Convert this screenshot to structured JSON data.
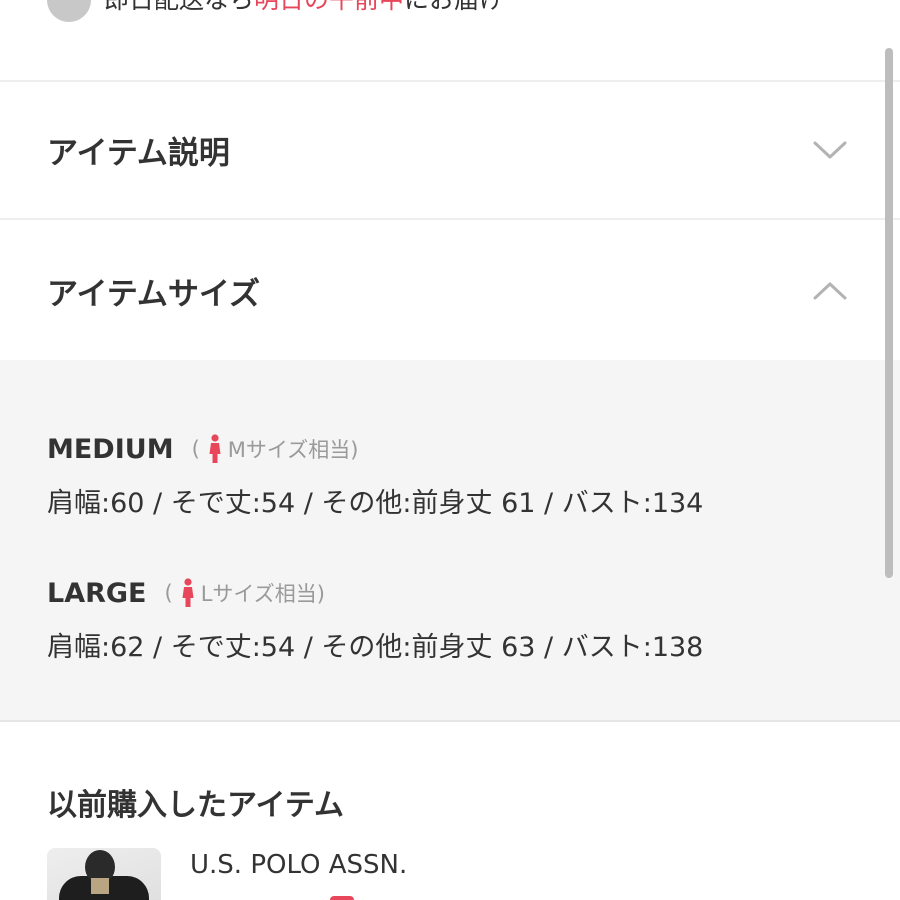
{
  "delivery": {
    "prefix": "即日配送なら",
    "highlight": "明日の午前中",
    "suffix": "にお届け"
  },
  "accordions": {
    "description": {
      "title": "アイテム説明",
      "expanded": false,
      "icon": "chevron-down-icon"
    },
    "size": {
      "title": "アイテムサイズ",
      "expanded": true,
      "icon": "chevron-up-icon"
    }
  },
  "sizes": [
    {
      "name": "MEDIUM",
      "paren_open": "(",
      "equivalent": "Mサイズ相当)",
      "detail": "肩幅:60 / そで丈:54 / その他:前身丈 61 / バスト:134"
    },
    {
      "name": "LARGE",
      "paren_open": "(",
      "equivalent": "Lサイズ相当)",
      "detail": "肩幅:62 / そで丈:54 / その他:前身丈 63 / バスト:138"
    }
  ],
  "history": {
    "title": "以前購入したアイテム",
    "items": [
      {
        "brand": "U.S. POLO ASSN."
      }
    ]
  },
  "colors": {
    "accent": "#e8465a",
    "text": "#333333",
    "muted": "#9a9a9a",
    "panel": "#f5f5f5"
  }
}
